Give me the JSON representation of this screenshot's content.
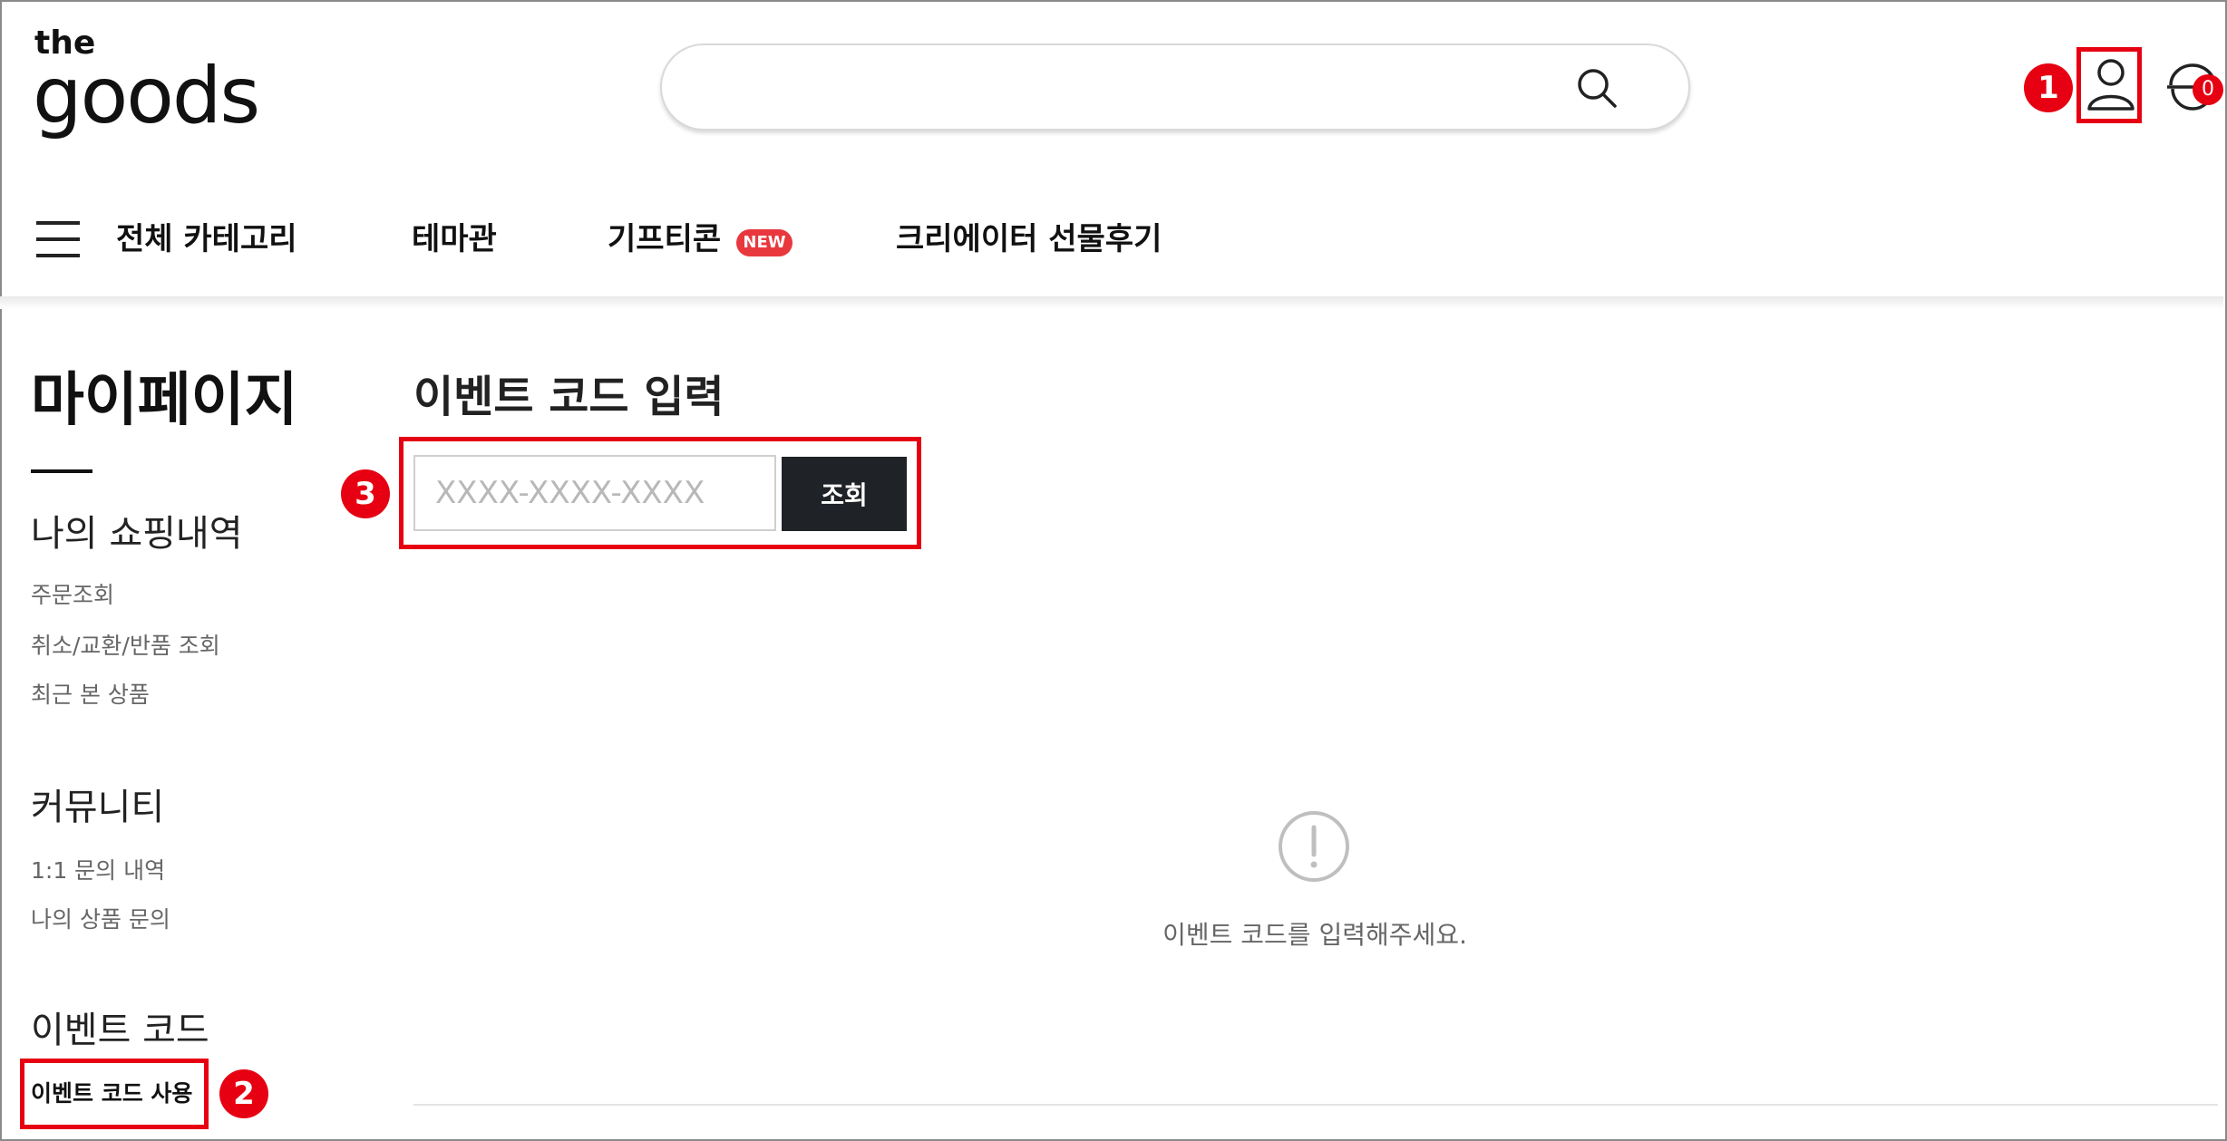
{
  "header": {
    "logo_top": "the",
    "logo_main": "goods",
    "search_placeholder": "",
    "cart_count": "0"
  },
  "annotations": [
    "1",
    "2",
    "3"
  ],
  "nav": {
    "items": [
      {
        "label": "전체 카테고리"
      },
      {
        "label": "테마관"
      },
      {
        "label": "기프티콘"
      },
      {
        "label": "크리에이터 선물후기"
      }
    ],
    "new_badge": "NEW"
  },
  "sidebar": {
    "title": "마이페이지",
    "sections": [
      {
        "heading": "나의 쇼핑내역",
        "links": [
          "주문조회",
          "취소/교환/반품 조회",
          "최근 본 상품"
        ]
      },
      {
        "heading": "커뮤니티",
        "links": [
          "1:1 문의 내역",
          "나의 상품 문의"
        ]
      },
      {
        "heading": "이벤트 코드",
        "links": [
          "이벤트 코드 사용"
        ]
      }
    ]
  },
  "main": {
    "title": "이벤트 코드 입력",
    "code_placeholder": "XXXX-XXXX-XXXX",
    "code_value": "",
    "search_button": "조회",
    "empty_message": "이벤트 코드를 입력해주세요."
  },
  "colors": {
    "accent_red": "#e60012",
    "button_dark": "#1f2227",
    "muted_text": "#666666"
  }
}
